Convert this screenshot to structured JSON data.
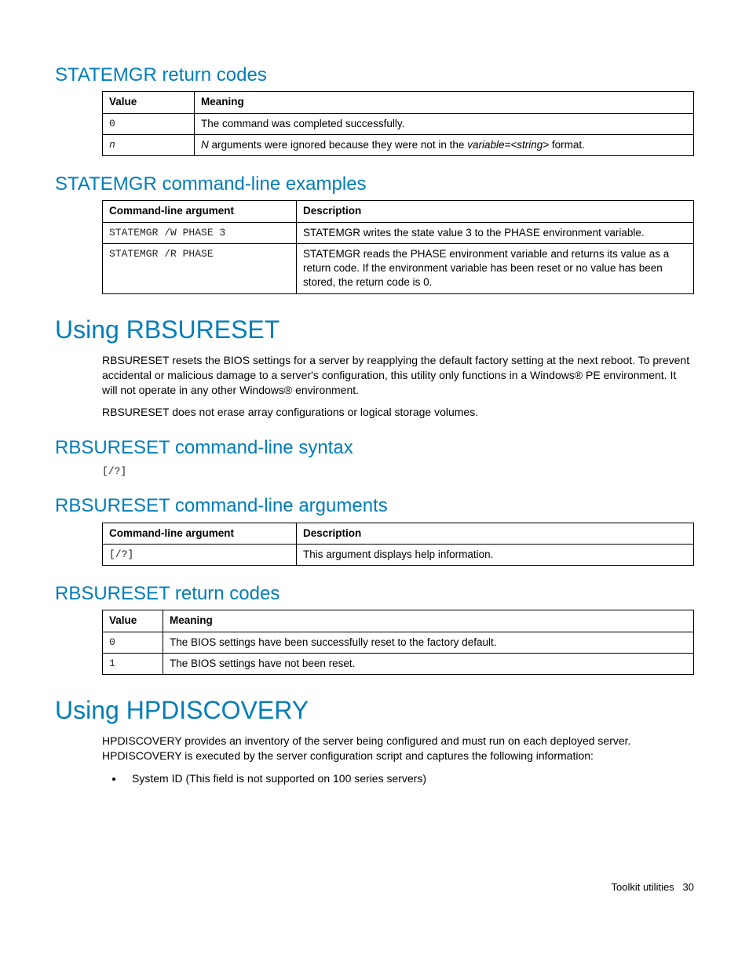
{
  "sections": {
    "statemgr_return": {
      "heading": "STATEMGR return codes",
      "headers": [
        "Value",
        "Meaning"
      ],
      "rows": [
        {
          "value": "0",
          "meaning": "The command was completed successfully."
        },
        {
          "value": "n",
          "meaning_prefix": "N",
          "meaning_mid": " arguments were ignored because they were not in the ",
          "meaning_var": "variable=<string>",
          "meaning_suffix": " format."
        }
      ]
    },
    "statemgr_examples": {
      "heading": "STATEMGR command-line examples",
      "headers": [
        "Command-line argument",
        "Description"
      ],
      "rows": [
        {
          "arg": "STATEMGR /W PHASE 3",
          "desc": "STATEMGR writes the state value 3 to the PHASE environment variable."
        },
        {
          "arg": "STATEMGR /R PHASE",
          "desc": "STATEMGR reads the PHASE environment variable and returns its value as a return code. If the environment variable has been reset or no value has been stored, the return code is 0."
        }
      ]
    },
    "rbsureset": {
      "heading": "Using RBSURESET",
      "p1": "RBSURESET resets the BIOS settings for a server by reapplying the default factory setting at the next reboot. To prevent accidental or malicious damage to a server's configuration, this utility only functions in a Windows® PE environment. It will not operate in any other Windows® environment.",
      "p2": "RBSURESET does not erase array configurations or logical storage volumes."
    },
    "rbsureset_syntax": {
      "heading": "RBSURESET command-line syntax",
      "syntax": "[/?]"
    },
    "rbsureset_args": {
      "heading": "RBSURESET command-line arguments",
      "headers": [
        "Command-line argument",
        "Description"
      ],
      "rows": [
        {
          "arg": "[/?]",
          "desc": "This argument displays help information."
        }
      ]
    },
    "rbsureset_return": {
      "heading": "RBSURESET return codes",
      "headers": [
        "Value",
        "Meaning"
      ],
      "rows": [
        {
          "value": "0",
          "meaning": "The BIOS settings have been successfully reset to the factory default."
        },
        {
          "value": "1",
          "meaning": "The BIOS settings have not been reset."
        }
      ]
    },
    "hpdiscovery": {
      "heading": "Using HPDISCOVERY",
      "p1": "HPDISCOVERY provides an inventory of the server being configured and must run on each deployed server. HPDISCOVERY is executed by the server configuration script and captures the following information:",
      "bullet1": "System ID (This field is not supported on 100 series servers)"
    }
  },
  "footer": {
    "label": "Toolkit utilities",
    "page": "30"
  }
}
